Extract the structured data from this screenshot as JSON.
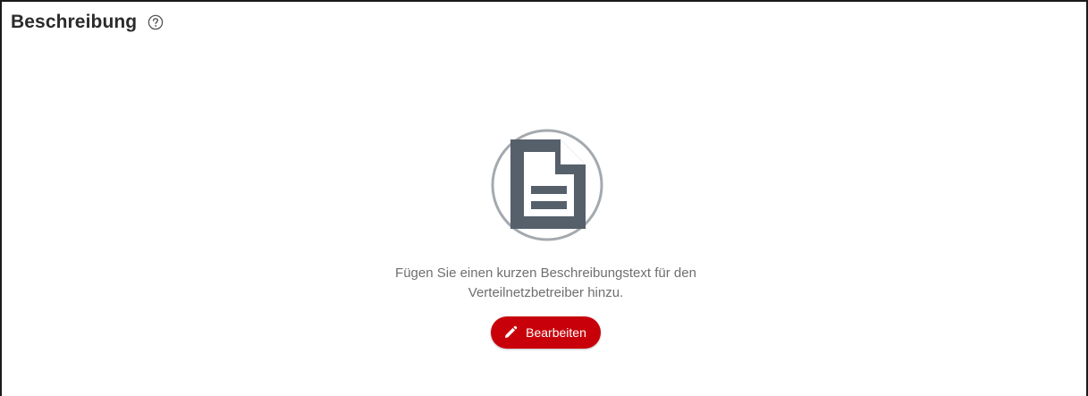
{
  "section": {
    "title": "Beschreibung",
    "help_icon": "help-circle-icon"
  },
  "empty_state": {
    "icon": "document-icon",
    "message_line1": "Fügen Sie einen kurzen Beschreibungstext für den",
    "message_line2": "Verteilnetzbetreiber hinzu.",
    "button_label": "Bearbeiten",
    "button_icon": "pencil-icon"
  },
  "colors": {
    "accent": "#c8000a",
    "icon_dark": "#56606b",
    "icon_ring": "#a4a9ae",
    "title": "#2b2b2b",
    "message": "#6f6f6f"
  }
}
